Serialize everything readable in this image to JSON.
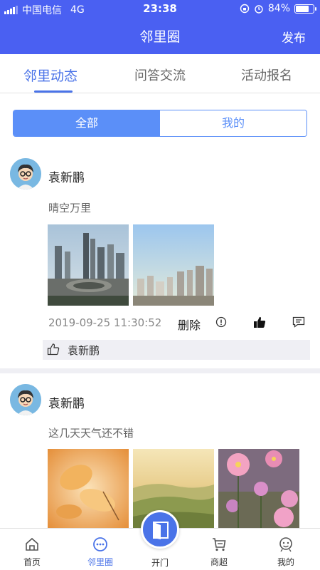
{
  "status": {
    "carrier": "中国电信",
    "network": "4G",
    "time": "23:38",
    "battery": "84%",
    "battery_level": 0.84
  },
  "header": {
    "title": "邻里圈",
    "publish_label": "发布"
  },
  "tabs": [
    {
      "label": "邻里动态",
      "active": true
    },
    {
      "label": "问答交流",
      "active": false
    },
    {
      "label": "活动报名",
      "active": false
    }
  ],
  "filter": {
    "all_label": "全部",
    "mine_label": "我的",
    "selected": "全部"
  },
  "posts": [
    {
      "author": "袁新鹏",
      "text": "晴空万里",
      "time": "2019-09-25 11:30:52",
      "delete_label": "删除",
      "likes": [
        "袁新鹏"
      ]
    },
    {
      "author": "袁新鹏",
      "text": "这几天天气还不错"
    }
  ],
  "tabbar": [
    {
      "label": "首页",
      "icon": "home-icon",
      "active": false
    },
    {
      "label": "邻里圈",
      "icon": "chat-bubble-icon",
      "active": true
    },
    {
      "label": "开门",
      "icon": "door-icon",
      "active": false
    },
    {
      "label": "商超",
      "icon": "cart-icon",
      "active": false
    },
    {
      "label": "我的",
      "icon": "person-icon",
      "active": false
    }
  ],
  "colors": {
    "brand": "#4a60f2",
    "accent": "#4a73e8",
    "segment": "#5b8ff8"
  }
}
